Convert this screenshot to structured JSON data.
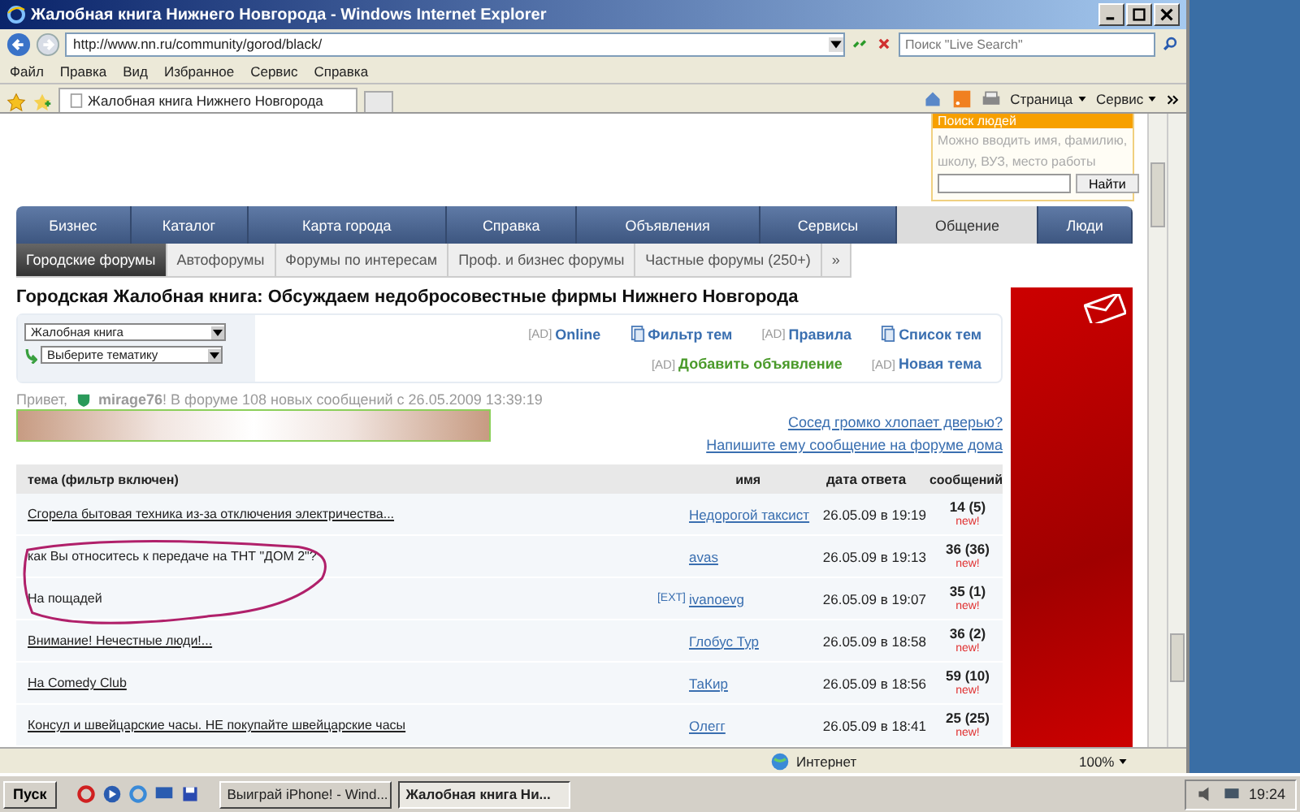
{
  "window": {
    "title": "Жалобная книга Нижнего Новгорода - Windows Internet Explorer"
  },
  "address_bar": {
    "url": "http://www.nn.ru/community/gorod/black/",
    "search_placeholder": "Поиск \"Live Search\""
  },
  "menu": [
    "Файл",
    "Правка",
    "Вид",
    "Избранное",
    "Сервис",
    "Справка"
  ],
  "browser_tab": {
    "title": "Жалобная книга Нижнего Новгорода"
  },
  "command_bar": [
    "Страница",
    "Сервис"
  ],
  "people_search": {
    "title": "Поиск людей",
    "hint": "Можно вводить имя, фамилию, школу, ВУЗ, место работы",
    "button": "Найти"
  },
  "nav": [
    {
      "label": "Бизнес",
      "selected": false
    },
    {
      "label": "Каталог",
      "selected": false
    },
    {
      "label": "Карта города",
      "selected": false
    },
    {
      "label": "Справка",
      "selected": false
    },
    {
      "label": "Объявления",
      "selected": false
    },
    {
      "label": "Сервисы",
      "selected": false
    },
    {
      "label": "Общение",
      "selected": true
    },
    {
      "label": "Люди",
      "selected": false
    }
  ],
  "subnav": [
    {
      "label": "Городские форумы",
      "selected": true
    },
    {
      "label": "Автофорумы",
      "selected": false
    },
    {
      "label": "Форумы по интересам",
      "selected": false
    },
    {
      "label": "Проф. и бизнес форумы",
      "selected": false
    },
    {
      "label": "Частные форумы (250+)",
      "selected": false
    }
  ],
  "subnav_more": "»",
  "heading": "Городская Жалобная книга: Обсуждаем недобросовестные фирмы Нижнего Новгорода",
  "filter": {
    "forum_select": "Жалобная книга",
    "topic_select": "Выберите тематику",
    "links": [
      [
        {
          "kind": "ad",
          "prefix": "[AD]",
          "label": "Online",
          "color": "#3a6fb0"
        },
        {
          "kind": "icon",
          "label": "Фильтр тем",
          "color": "#3a6fb0"
        },
        {
          "kind": "ad",
          "prefix": "[AD]",
          "label": "Правила",
          "color": "#3a6fb0"
        },
        {
          "kind": "icon",
          "label": "Список тем",
          "color": "#3a6fb0"
        }
      ],
      [
        {
          "kind": "ad",
          "prefix": "[AD]",
          "label": "Добавить объявление",
          "color": "#4a9a2a"
        },
        {
          "kind": "ad",
          "prefix": "[AD]",
          "label": "Новая тема",
          "color": "#3a6fb0"
        }
      ]
    ]
  },
  "greeting": {
    "prefix": "Привет,",
    "text": "**mirage76**! В форуме 108 новых сообщений с 26.05.2009 13:39:19"
  },
  "side_links": [
    "Сосед громко хлопает дверью?",
    "Напишите ему сообщение на форуме дома"
  ],
  "table": {
    "columns": [
      "тема (фильтр включен)",
      "имя",
      "дата ответа",
      "сообщений"
    ],
    "rows": [
      {
        "title": "Сгорела бытовая техника из-за отключения электричества...",
        "link": true,
        "tag": "",
        "author": "Недорогой таксист",
        "date": "26.05.09 в 19:19",
        "count": "14 (5)",
        "new": "new!"
      },
      {
        "title": "как Вы относитесь к передаче на ТНТ \"ДОМ 2\"?",
        "link": false,
        "tag": "",
        "author": "avas",
        "date": "26.05.09 в 19:13",
        "count": "36 (36)",
        "new": "new!"
      },
      {
        "title": "На пощадей",
        "link": false,
        "tag": "[EXT]",
        "author": "ivanoevg",
        "date": "26.05.09 в 19:07",
        "count": "35 (1)",
        "new": "new!"
      },
      {
        "title": "Внимание! Нечестные люди!...",
        "link": true,
        "tag": "",
        "author": "Глобус Тур",
        "date": "26.05.09 в 18:58",
        "count": "36 (2)",
        "new": "new!"
      },
      {
        "title": "На Comedy Club",
        "link": true,
        "tag": "",
        "author": "ТаКир",
        "date": "26.05.09 в 18:56",
        "count": "59 (10)",
        "new": "new!"
      },
      {
        "title": "Консул и швейцарские часы. НЕ покупайте швейцарские часы",
        "link": true,
        "tag": "",
        "author": "Олегг",
        "date": "26.05.09 в 18:41",
        "count": "25 (25)",
        "new": "new!"
      }
    ]
  },
  "status_bar": {
    "zone": "Интернет",
    "zoom": "100%"
  },
  "taskbar": {
    "start": "Пуск",
    "tasks": [
      {
        "label": "Выиграй iPhone! - Wind...",
        "selected": false
      },
      {
        "label": "Жалобная книга Ни...",
        "selected": true
      }
    ],
    "clock": "19:24"
  }
}
